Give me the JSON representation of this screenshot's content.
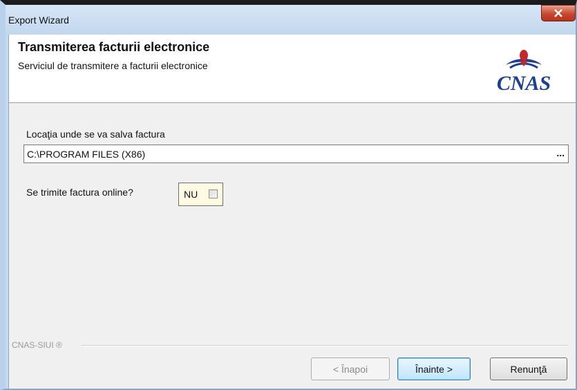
{
  "window": {
    "title": "Export Wizard",
    "close_glyph": "x"
  },
  "header": {
    "title": "Transmiterea facturii electronice",
    "subtitle": "Serviciul de transmitere a facturii electronice",
    "logo_text": "CNAS"
  },
  "form": {
    "location_label": "Locaţia unde se va salva factura",
    "location_value": "C:\\PROGRAM FILES (X86)",
    "browse_label": "...",
    "online_label": "Se trimite factura online?",
    "online_value": "NU",
    "online_checked": false
  },
  "footer": {
    "brand": "CNAS-SIUI ®"
  },
  "buttons": {
    "back": "< Înapoi",
    "next": "Înainte >",
    "cancel": "Renunţă"
  },
  "colors": {
    "accent_blue": "#1d3f8f",
    "close_red": "#c7482f",
    "active_button": "#bee6fd"
  }
}
